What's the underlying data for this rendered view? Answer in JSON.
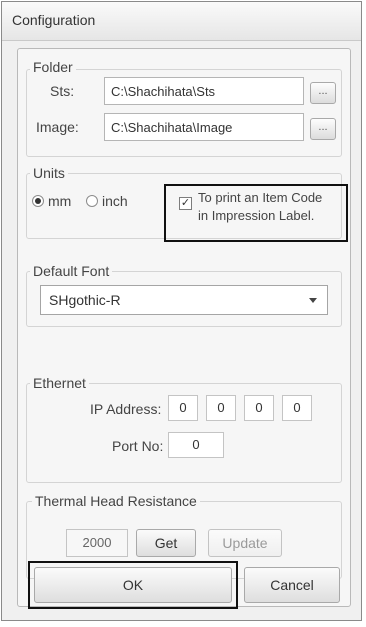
{
  "window": {
    "title": "Configuration"
  },
  "folder": {
    "label": "Folder",
    "sts_label": "Sts:",
    "sts_value": "C:\\Shachihata\\Sts",
    "image_label": "Image:",
    "image_value": "C:\\Shachihata\\Image",
    "browse_label": "..."
  },
  "units": {
    "label": "Units",
    "options": [
      {
        "label": "mm",
        "selected": true
      },
      {
        "label": "inch",
        "selected": false
      }
    ],
    "item_code_checkbox_line1": "To print an Item Code",
    "item_code_checkbox_line2": "in Impression Label.",
    "item_code_checked": true,
    "check_mark": "✓"
  },
  "font": {
    "label": "Default Font",
    "selected": "SHgothic-R"
  },
  "ethernet": {
    "label": "Ethernet",
    "ip_label": "IP Address:",
    "ip_octets": [
      "0",
      "0",
      "0",
      "0"
    ],
    "port_label": "Port No:",
    "port_value": "0"
  },
  "thermal": {
    "label": "Thermal Head Resistance",
    "value": "2000",
    "get_label": "Get",
    "update_label": "Update"
  },
  "buttons": {
    "ok_label": "OK",
    "cancel_label": "Cancel"
  }
}
